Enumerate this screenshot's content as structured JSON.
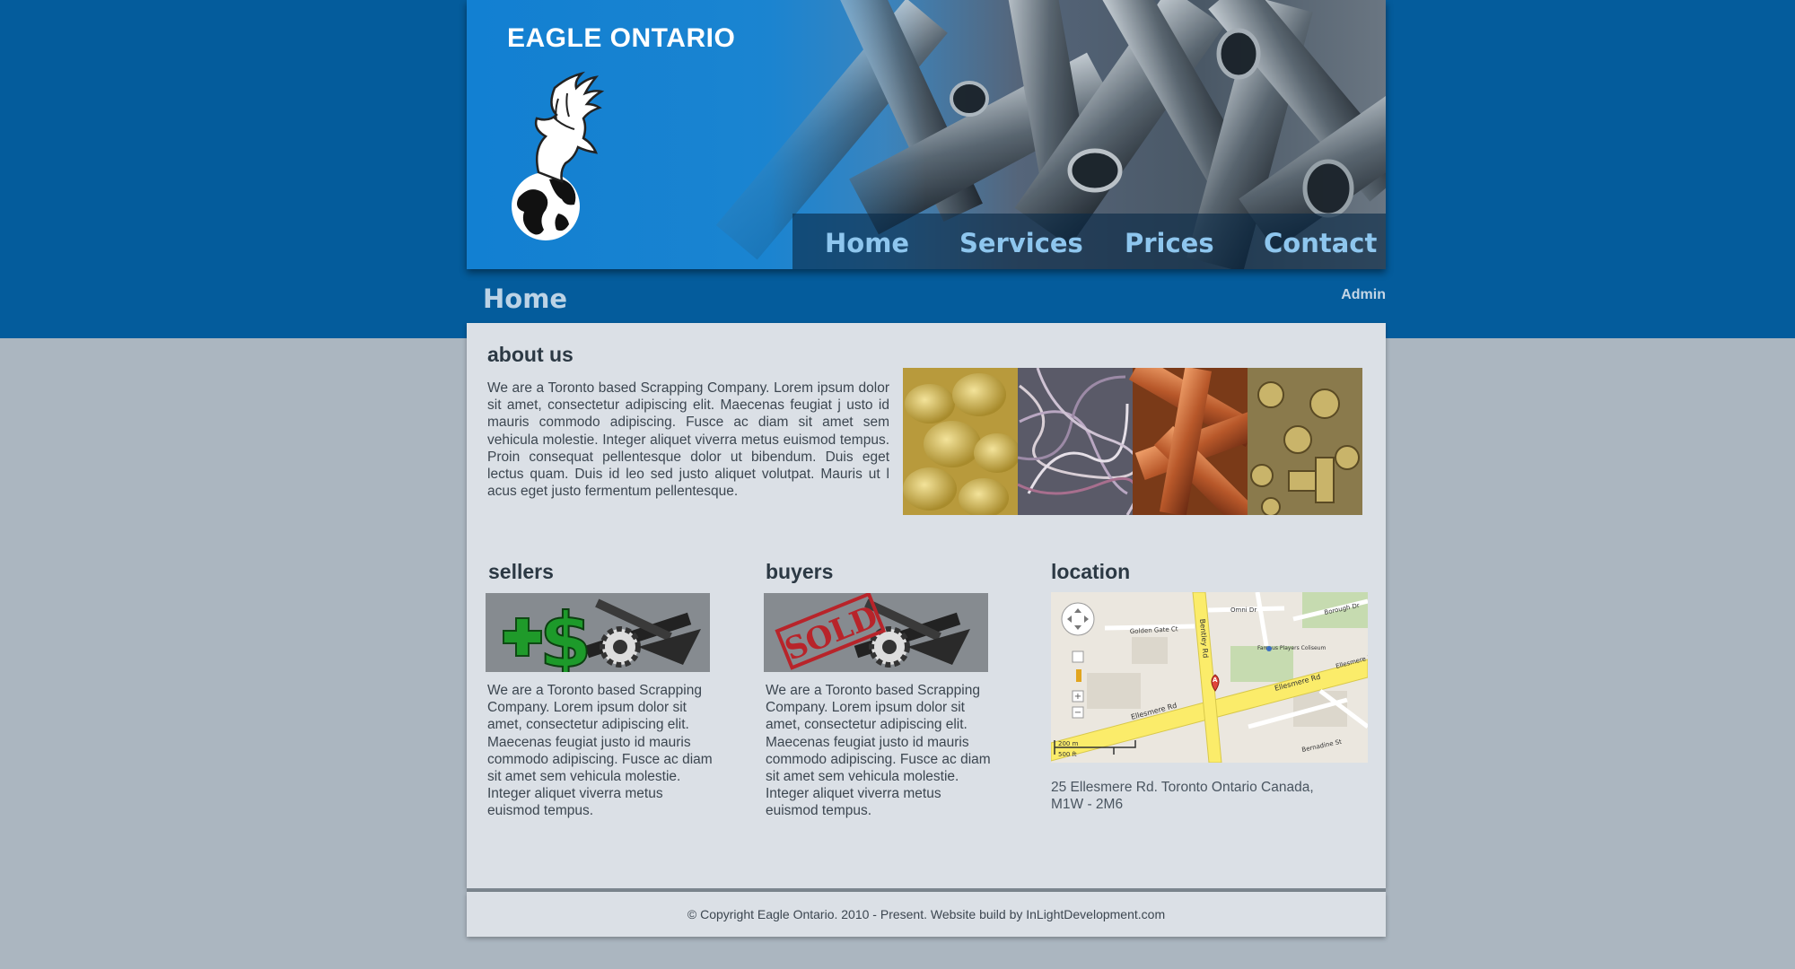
{
  "header": {
    "logo_text": "EAGLE ONTARIO",
    "nav": [
      "Home",
      "Services",
      "Prices",
      "Contact"
    ]
  },
  "page": {
    "title": "Home",
    "admin_label": "Admin"
  },
  "about": {
    "heading": "about us",
    "text": "We are a Toronto based Scrapping Company. Lorem ipsum dolor sit amet, consectetur adipiscing elit. Maecenas feugiat j usto id mauris commodo adipiscing. Fusce ac diam sit amet sem vehicula molestie. Integer aliquet viverra metus euismod tempus. Proin consequat pellentesque dolor ut bibendum. Duis eget lectus quam. Duis id leo sed justo aliquet volutpat. Mauris ut l acus eget justo fermentum pellentesque."
  },
  "sellers": {
    "heading": "sellers",
    "text": "We are a Toronto based Scrapping Company. Lorem ipsum dolor sit amet, consectetur adipiscing elit. Maecenas feugiat justo id mauris commodo adipiscing. Fusce ac diam sit amet sem vehicula molestie. Integer aliquet viverra metus euismod tempus."
  },
  "buyers": {
    "heading": "buyers",
    "stamp": "SOLD",
    "text": "We are a Toronto based Scrapping Company. Lorem ipsum dolor sit amet, consectetur adipiscing elit. Maecenas feugiat justo id mauris commodo adipiscing. Fusce ac diam sit amet sem vehicula molestie. Integer aliquet viverra metus euismod tempus."
  },
  "location": {
    "heading": "location",
    "address": "25 Ellesmere Rd. Toronto Ontario Canada, M1W - 2M6",
    "map_labels": {
      "road1": "Ellesmere Rd",
      "road2": "Ellesmere Rd",
      "road3": "Ellesmere Rd",
      "road4": "Bentley Rd",
      "road5": "Golden Gate Ct",
      "road6": "Omni Dr",
      "road7": "Borough Dr",
      "road8": "Bernadine St",
      "poi": "Famous Players Coliseum",
      "scale_m": "200 m",
      "scale_ft": "500 ft",
      "marker": "A"
    }
  },
  "footer": {
    "text": "© Copyright Eagle Ontario. 2010 - Present. Website build by InLightDevelopment.com"
  },
  "colors": {
    "band": "#045c9c",
    "body_bg": "#abb6c0",
    "panel": "#dbe0e6",
    "nav_text": "#8ec6ee"
  }
}
